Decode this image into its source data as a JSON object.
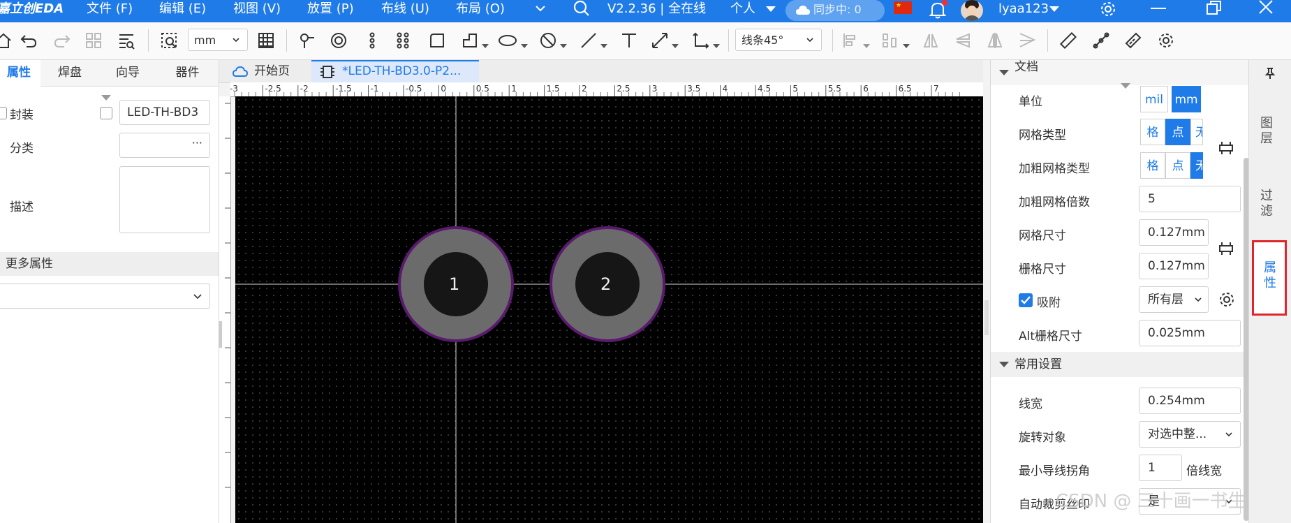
{
  "titlebar": {
    "logo": "嘉立创EDA",
    "menus": [
      "文件 (F)",
      "编辑 (E)",
      "视图 (V)",
      "放置 (P)",
      "布线 (U)",
      "布局 (O)"
    ],
    "version": "V2.2.36 | 全在线",
    "mode": "个人",
    "sync": "同步中: 0",
    "username": "lyaa123"
  },
  "toolbar": {
    "unit_select": "mm",
    "route_mode": "线条45°"
  },
  "left_panel": {
    "tabs": [
      "属性",
      "焊盘",
      "向导",
      "器件"
    ],
    "active_tab": "属性",
    "footprint_label": "封装",
    "footprint_value": "LED-TH-BD3",
    "category_label": "分类",
    "category_more": "···",
    "description_label": "描述",
    "more_props": "更多属性"
  },
  "doc_tabs": {
    "home": "开始页",
    "current": "*LED-TH-BD3.0-P2..."
  },
  "ruler": {
    "top_labels": [
      "-3",
      "-2.5",
      "-2",
      "-1.5",
      "-1",
      "-0.5",
      "0",
      "0.5",
      "1",
      "1.5",
      "2",
      "2.5",
      "3",
      "3.5",
      "4",
      "4.5",
      "5",
      "5.5",
      "6",
      "6.5",
      "7"
    ]
  },
  "canvas": {
    "pads": [
      {
        "label": "1"
      },
      {
        "label": "2"
      }
    ]
  },
  "right_panel": {
    "doc_section": "文档",
    "unit_label": "单位",
    "unit_options": [
      "mil",
      "mm"
    ],
    "unit_active": "mm",
    "grid_type_label": "网格类型",
    "grid_type_options": [
      "格",
      "点",
      "无"
    ],
    "grid_type_active": "点",
    "bold_grid_type_label": "加粗网格类型",
    "bold_grid_type_options": [
      "格",
      "点",
      "无"
    ],
    "bold_grid_type_active": "无",
    "bold_grid_mult_label": "加粗网格倍数",
    "bold_grid_mult_value": "5",
    "grid_size_label": "网格尺寸",
    "grid_size_value": "0.127mm",
    "snap_grid_label": "栅格尺寸",
    "snap_grid_value": "0.127mm",
    "snap_label": "吸附",
    "snap_checked": true,
    "snap_layer_value": "所有层",
    "alt_grid_label": "Alt栅格尺寸",
    "alt_grid_value": "0.025mm",
    "common_section": "常用设置",
    "line_width_label": "线宽",
    "line_width_value": "0.254mm",
    "rotate_label": "旋转对象",
    "rotate_value": "对选中整...",
    "min_corner_label": "最小导线拐角",
    "min_corner_value": "1",
    "min_corner_unit": "倍线宽",
    "auto_trim_label": "自动裁剪丝印",
    "auto_trim_value": "是"
  },
  "side_tabs": [
    "图层",
    "过滤",
    "属性"
  ],
  "watermark": "CSDN @ 三十画一书生",
  "colors": {
    "accent": "#1f7be8",
    "canvas_bg": "#000000",
    "pad_ring": "#6b6b6b",
    "pad_hole": "#161616",
    "pad_outline": "#5a1a6e",
    "highlight_box": "#e0262b"
  }
}
